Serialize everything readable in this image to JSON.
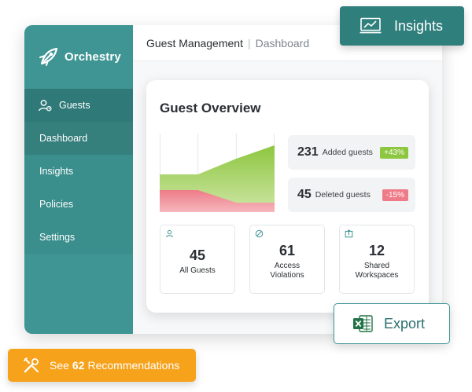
{
  "app": {
    "name": "Orchestry",
    "colors": {
      "sidebar": "#3e9593",
      "accent": "#2f7f7c",
      "orange": "#f7a21b",
      "up": "#8dc63f",
      "down": "#ee7b87"
    }
  },
  "sidebar": {
    "items": [
      {
        "label": "Guests",
        "icon": "user-icon",
        "active": true
      },
      {
        "label": "Dashboard"
      },
      {
        "label": "Insights"
      },
      {
        "label": "Policies"
      },
      {
        "label": "Settings"
      }
    ]
  },
  "topbar": {
    "title": "Guest Management",
    "subtitle": "Dashboard"
  },
  "overview": {
    "title": "Guest Overview",
    "added": {
      "value": "231",
      "label": "Added guests",
      "change": "+43%"
    },
    "deleted": {
      "value": "45",
      "label": "Deleted guests",
      "change": "-15%"
    },
    "tiles": [
      {
        "value": "45",
        "label": "All Guests",
        "icon": "user-icon"
      },
      {
        "value": "61",
        "label_line1": "Access",
        "label_line2": "Violations",
        "icon": "prohibited-icon"
      },
      {
        "value": "12",
        "label_line1": "Shared",
        "label_line2": "Workspaces",
        "icon": "share-icon"
      }
    ]
  },
  "chart_data": {
    "type": "area",
    "x": [
      0,
      1,
      2,
      3
    ],
    "series": [
      {
        "values": [
          0.28,
          0.28,
          0.12,
          0.12
        ],
        "color": "#ee7b87"
      },
      {
        "values": [
          0.48,
          0.48,
          0.68,
          0.85
        ],
        "color": "#8dc63f"
      }
    ],
    "ylim": [
      0,
      1
    ],
    "grid": true
  },
  "buttons": {
    "insights": {
      "label": "Insights",
      "icon": "monitor-chart-icon"
    },
    "export": {
      "label": "Export",
      "icon": "excel-icon"
    },
    "recommendations": {
      "prefix": "See",
      "count": "62",
      "suffix": "Recommendations",
      "icon": "tools-icon"
    }
  }
}
